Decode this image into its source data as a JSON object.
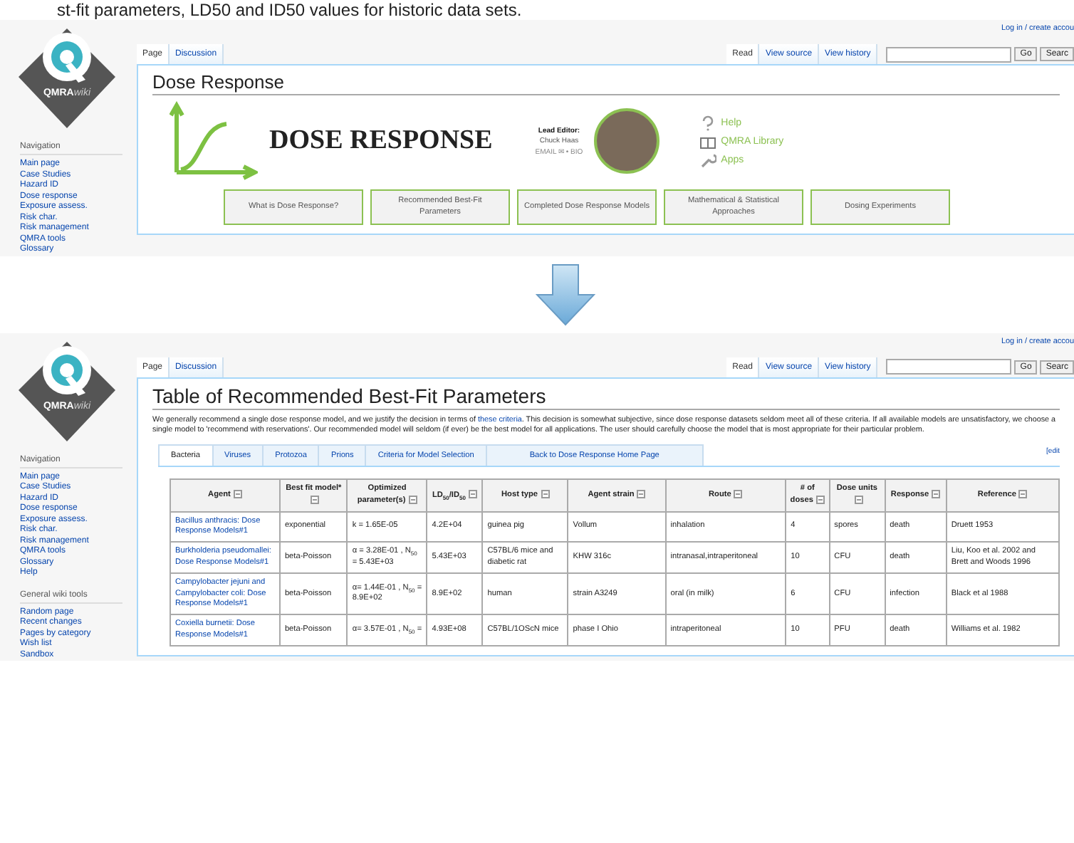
{
  "caption": "st-fit parameters, LD50 and ID50 values for historic data sets.",
  "top_page": {
    "kind": "portal",
    "user_links": "Log in / create accou",
    "logo": {
      "name": "QMRA",
      "suffix": "wiki"
    },
    "navigation": {
      "heading": "Navigation",
      "items": [
        "Main page",
        "Case Studies",
        "Hazard ID",
        "Dose response",
        "Exposure assess.",
        "Risk char.",
        "Risk management",
        "QMRA tools",
        "Glossary"
      ]
    },
    "page_tabs": [
      {
        "label": "Page",
        "selected": true
      },
      {
        "label": "Discussion",
        "selected": false
      }
    ],
    "view_tabs": [
      {
        "label": "Read",
        "selected": true
      },
      {
        "label": "View source",
        "selected": false
      },
      {
        "label": "View history",
        "selected": false
      }
    ],
    "search_buttons": [
      "Go",
      "Searc"
    ],
    "title": "Dose Response",
    "banner": {
      "heading": "DOSE RESPONSE",
      "editor_label": "Lead Editor:",
      "editor_name": "Chuck Haas",
      "editor_links": "EMAIL ✉ • BIO",
      "links": [
        {
          "kind": "help",
          "label": "Help"
        },
        {
          "kind": "library",
          "label": "QMRA Library"
        },
        {
          "kind": "apps",
          "label": "Apps"
        }
      ]
    },
    "nav_buttons": [
      "What is Dose Response?",
      "Recommended Best-Fit Parameters",
      "Completed Dose Response Models",
      "Mathematical & Statistical Approaches",
      "Dosing Experiments"
    ]
  },
  "bottom_page": {
    "kind": "article",
    "user_links": "Log in / create accou",
    "logo": {
      "name": "QMRA",
      "suffix": "wiki"
    },
    "navigation": {
      "heading": "Navigation",
      "items": [
        "Main page",
        "Case Studies",
        "Hazard ID",
        "Dose response",
        "Exposure assess.",
        "Risk char.",
        "Risk management",
        "QMRA tools",
        "Glossary",
        "Help"
      ]
    },
    "tools": {
      "heading": "General wiki tools",
      "items": [
        "Random page",
        "Recent changes",
        "Pages by category",
        "Wish list",
        "Sandbox"
      ]
    },
    "page_tabs": [
      {
        "label": "Page",
        "selected": true
      },
      {
        "label": "Discussion",
        "selected": false
      }
    ],
    "view_tabs": [
      {
        "label": "Read",
        "selected": true
      },
      {
        "label": "View source",
        "selected": false
      },
      {
        "label": "View history",
        "selected": false
      }
    ],
    "search_buttons": [
      "Go",
      "Searc"
    ],
    "title": "Table of Recommended Best-Fit Parameters",
    "intro": [
      {
        "kind": "text",
        "text": "We generally recommend a single dose response model, and we justify the decision in terms of "
      },
      {
        "kind": "link",
        "text": "these criteria"
      },
      {
        "kind": "text",
        "text": ". This decision is somewhat subjective, since dose response datasets seldom meet all of these criteria. If all available models are unsatisfactory, we choose a single model to 'recommend with reservations'. Our recommended model will seldom (if ever) be the best model for all applications. The user should carefully choose the model that is most appropriate for their particular problem."
      }
    ],
    "category_tabs": [
      {
        "label": "Bacteria",
        "selected": true
      },
      {
        "label": "Viruses",
        "selected": false
      },
      {
        "label": "Protozoa",
        "selected": false
      },
      {
        "label": "Prions",
        "selected": false
      },
      {
        "label": "Criteria for Model Selection",
        "selected": false
      },
      {
        "label": "Back to Dose Response Home Page",
        "selected": false
      }
    ],
    "edit_link": "[edit",
    "table": {
      "columns": [
        "Agent",
        "Best fit model*",
        "Optimized parameter(s)",
        "LD$_{50}$/ID$_{50}$",
        "Host type",
        "Agent strain",
        "Route",
        "# of doses",
        "Dose units",
        "Response",
        "Reference"
      ],
      "rows": [
        [
          "Bacillus anthracis: Dose Response Models#1",
          "exponential",
          "k = 1.65E-05",
          "4.2E+04",
          "guinea pig",
          "Vollum",
          "inhalation",
          "4",
          "spores",
          "death",
          "Druett 1953"
        ],
        [
          "Burkholderia pseudomallei: Dose Response Models#1",
          "beta-Poisson",
          "α = 3.28E-01 , N$_{50}$ = 5.43E+03",
          "5.43E+03",
          "C57BL/6 mice and diabetic rat",
          "KHW 316c",
          "intranasal,intraperitoneal",
          "10",
          "CFU",
          "death",
          "Liu, Koo et al. 2002 and Brett and Woods 1996"
        ],
        [
          "Campylobacter jejuni and Campylobacter coli: Dose Response Models#1",
          "beta-Poisson",
          "α= 1.44E-01 , N$_{50}$ = 8.9E+02",
          "8.9E+02",
          "human",
          "strain A3249",
          "oral (in milk)",
          "6",
          "CFU",
          "infection",
          "Black et al 1988"
        ],
        [
          "Coxiella burnetii: Dose Response Models#1",
          "beta-Poisson",
          "α= 3.57E-01 , N$_{50}$ =",
          "4.93E+08",
          "C57BL/1OScN mice",
          "phase I Ohio",
          "intraperitoneal",
          "10",
          "PFU",
          "death",
          "Williams et al. 1982"
        ]
      ]
    }
  }
}
